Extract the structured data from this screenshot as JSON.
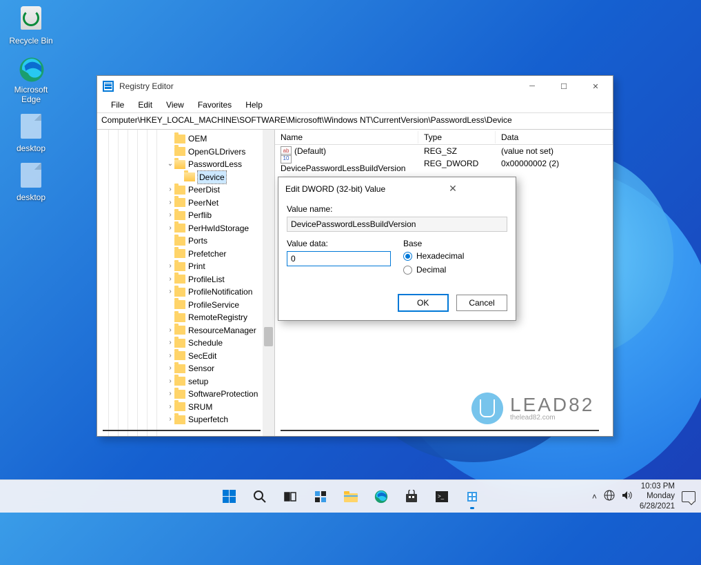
{
  "desktop_icons": {
    "recycle_bin": "Recycle Bin",
    "edge": "Microsoft Edge",
    "txt1": "desktop",
    "txt2": "desktop"
  },
  "regedit": {
    "title": "Registry Editor",
    "menu": {
      "file": "File",
      "edit": "Edit",
      "view": "View",
      "favorites": "Favorites",
      "help": "Help"
    },
    "address": "Computer\\HKEY_LOCAL_MACHINE\\SOFTWARE\\Microsoft\\Windows NT\\CurrentVersion\\PasswordLess\\Device",
    "tree": {
      "items": [
        "OEM",
        "OpenGLDrivers",
        "PasswordLess",
        "Device",
        "PeerDist",
        "PeerNet",
        "Perflib",
        "PerHwIdStorage",
        "Ports",
        "Prefetcher",
        "Print",
        "ProfileList",
        "ProfileNotification",
        "ProfileService",
        "RemoteRegistry",
        "ResourceManager",
        "Schedule",
        "SecEdit",
        "Sensor",
        "setup",
        "SoftwareProtection",
        "SRUM",
        "Superfetch"
      ],
      "expandable": [
        false,
        false,
        true,
        false,
        true,
        true,
        true,
        true,
        false,
        false,
        true,
        true,
        true,
        false,
        false,
        true,
        true,
        true,
        true,
        true,
        true,
        true,
        true
      ],
      "open_index": 2,
      "selected_index": 3
    },
    "list": {
      "cols": {
        "name": "Name",
        "type": "Type",
        "data": "Data"
      },
      "rows": [
        {
          "icon": "sz",
          "name": "(Default)",
          "type": "REG_SZ",
          "data": "(value not set)"
        },
        {
          "icon": "dw",
          "name": "DevicePasswordLessBuildVersion",
          "type": "REG_DWORD",
          "data": "0x00000002 (2)"
        }
      ]
    }
  },
  "dialog": {
    "title": "Edit DWORD (32-bit) Value",
    "value_name_label": "Value name:",
    "value_name": "DevicePasswordLessBuildVersion",
    "value_data_label": "Value data:",
    "value_data": "0",
    "base_label": "Base",
    "hex_label": "Hexadecimal",
    "dec_label": "Decimal",
    "ok": "OK",
    "cancel": "Cancel"
  },
  "watermark": {
    "big": "LEAD82",
    "small": "thelead82.com"
  },
  "taskbar": {
    "time": "10:03 PM",
    "day": "Monday",
    "date": "6/28/2021"
  }
}
